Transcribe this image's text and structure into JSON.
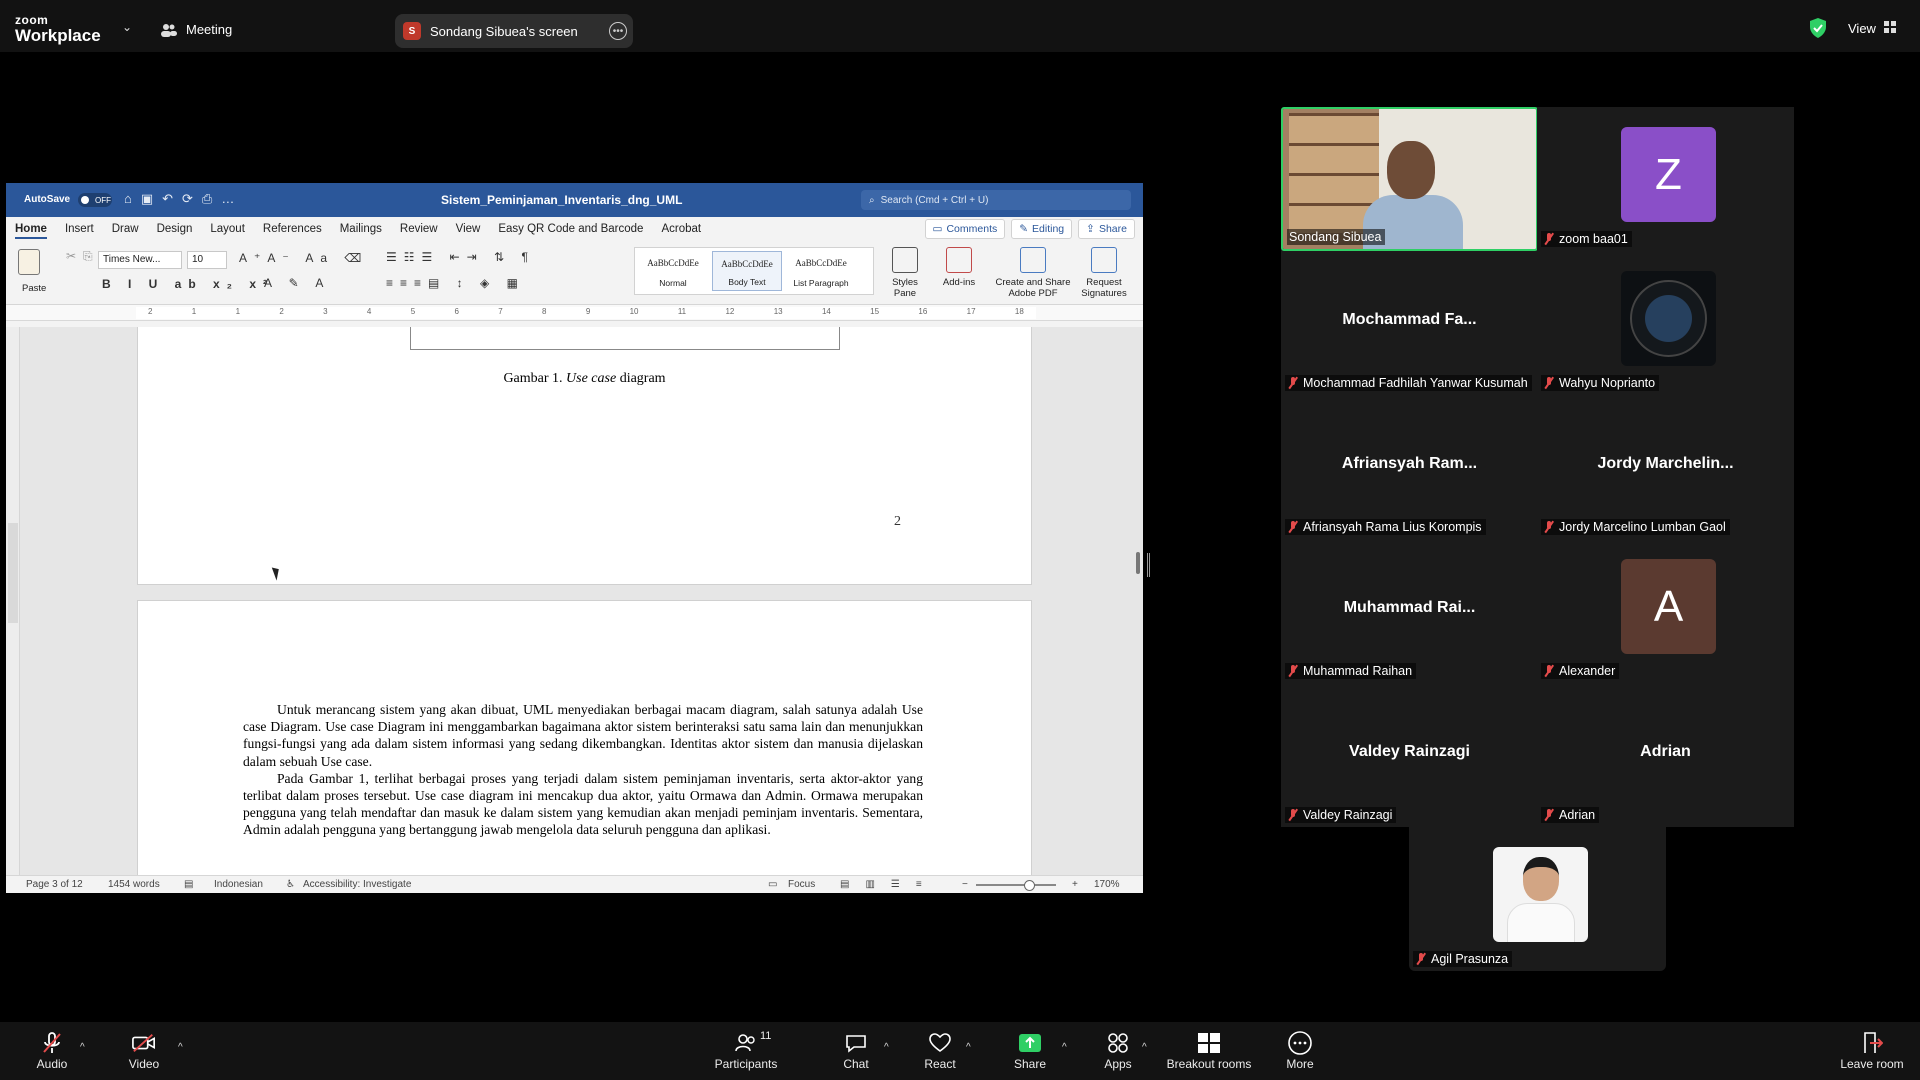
{
  "topbar": {
    "logo_top": "zoom",
    "logo_bottom": "Workplace",
    "meeting_label": "Meeting",
    "screen_badge": "S",
    "screen_label": "Sondang Sibuea's screen",
    "view_label": "View",
    "colors": {
      "shield": "#2fcf65",
      "screen_badge": "#c0392b"
    }
  },
  "word": {
    "autosave_label": "AutoSave",
    "autosave_state": "OFF",
    "doc_title": "Sistem_Peminjaman_Inventaris_dng_UML",
    "search_placeholder": "Search (Cmd + Ctrl + U)",
    "tabs": [
      "Home",
      "Insert",
      "Draw",
      "Design",
      "Layout",
      "References",
      "Mailings",
      "Review",
      "View",
      "Easy QR Code and Barcode",
      "Acrobat"
    ],
    "active_tab": "Home",
    "right_buttons": {
      "comments": "Comments",
      "editing": "Editing",
      "share": "Share"
    },
    "ribbon": {
      "paste": "Paste",
      "font_name": "Times New...",
      "font_size": "10",
      "style_sample": "AaBbCcDdEe",
      "styles": [
        "Normal",
        "Body Text",
        "List Paragraph"
      ],
      "styles_pane": "Styles Pane",
      "addins": "Add-ins",
      "create_pdf": "Create and Share Adobe PDF",
      "request_sig": "Request Signatures"
    },
    "ruler_ticks": [
      "2",
      "1",
      "1",
      "2",
      "3",
      "4",
      "5",
      "6",
      "7",
      "8",
      "9",
      "10",
      "11",
      "12",
      "13",
      "14",
      "15",
      "16",
      "17",
      "18"
    ],
    "page1": {
      "caption_prefix": "Gambar 1. ",
      "caption_italic": "Use case",
      "caption_suffix": " diagram",
      "page_number": "2"
    },
    "page2": {
      "p1": "Untuk merancang sistem yang akan dibuat, UML menyediakan berbagai macam diagram, salah satunya adalah Use case Diagram. Use case Diagram ini menggambarkan bagaimana aktor sistem berinteraksi satu sama lain dan menunjukkan fungsi-fungsi yang ada dalam sistem informasi yang sedang dikembangkan. Identitas aktor sistem dan manusia dijelaskan dalam sebuah Use case.",
      "p2": "Pada Gambar 1, terlihat berbagai proses yang terjadi dalam sistem peminjaman inventaris, serta aktor-aktor yang terlibat dalam proses tersebut. Use case diagram ini mencakup dua aktor, yaitu Ormawa dan Admin. Ormawa merupakan pengguna yang telah mendaftar dan masuk ke dalam sistem yang kemudian akan menjadi peminjam inventaris. Sementara, Admin adalah pengguna yang bertanggung jawab mengelola data seluruh pengguna dan aplikasi."
    },
    "status": {
      "page": "Page 3 of 12",
      "words": "1454 words",
      "language": "Indonesian",
      "accessibility": "Accessibility: Investigate",
      "focus": "Focus",
      "zoom": "170%"
    },
    "colors": {
      "titlebar": "#2b579a"
    }
  },
  "participants": [
    {
      "tile_name": "Sondang Sibuea",
      "type": "video",
      "muted": false
    },
    {
      "tile_name": "zoom baa01",
      "type": "avatar",
      "letter": "Z",
      "color": "#8a4fc8",
      "muted": true
    },
    {
      "tile_name": "Mochammad Fadhilah Yanwar Kusumah",
      "big_name": "Mochammad  Fa...",
      "type": "name",
      "muted": true
    },
    {
      "tile_name": "Wahyu Noprianto",
      "type": "watch",
      "muted": true
    },
    {
      "tile_name": "Afriansyah Rama Lius Korompis",
      "big_name": "Afriansyah  Ram...",
      "type": "name",
      "muted": true
    },
    {
      "tile_name": "Jordy Marcelino Lumban Gaol",
      "big_name": "Jordy  Marchelin...",
      "type": "name",
      "muted": true
    },
    {
      "tile_name": "Muhammad Raihan",
      "big_name": "Muhammad  Rai...",
      "type": "name",
      "muted": true
    },
    {
      "tile_name": "Alexander",
      "type": "avatar",
      "letter": "A",
      "color": "#5b3a30",
      "muted": true
    },
    {
      "tile_name": "Valdey Rainzagi",
      "big_name": "Valdey Rainzagi",
      "type": "name",
      "muted": true
    },
    {
      "tile_name": "Adrian",
      "big_name": "Adrian",
      "type": "name",
      "muted": true
    },
    {
      "tile_name": "Agil Prasunza",
      "type": "photo",
      "muted": true
    }
  ],
  "toolbar": {
    "audio": "Audio",
    "video": "Video",
    "participants": "Participants",
    "participants_count": "11",
    "chat": "Chat",
    "react": "React",
    "share": "Share",
    "apps": "Apps",
    "breakout": "Breakout rooms",
    "more": "More",
    "leave": "Leave room",
    "colors": {
      "share": "#2fcf65",
      "leave": "#e34b4b"
    }
  }
}
